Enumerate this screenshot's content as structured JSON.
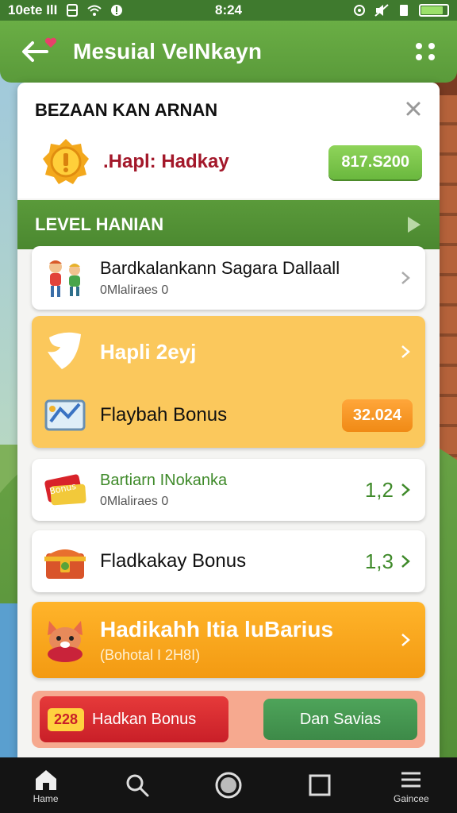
{
  "status": {
    "left_text": "10ete IlI",
    "time": "8:24"
  },
  "header": {
    "title": "Mesuial VeINkayn",
    "accent": "#5a9a3a"
  },
  "panel": {
    "title": "BEZAAN KAN ARNAN",
    "reward": {
      "label": ".Hapl: Hadkay",
      "value": "817.S200"
    },
    "level_bar": "LEVEL HANIAN"
  },
  "items": [
    {
      "title": "Bardkalankann Sagara Dallaall",
      "subtitle": "0Mlaliraes 0"
    },
    {
      "title": "Hapli 2eyj"
    },
    {
      "title": "Flaybah Bonus",
      "value": "32.024"
    },
    {
      "title": "Bartiarn INokanka",
      "subtitle": "0Mlaliraes 0",
      "value": "1,2"
    },
    {
      "title": "Fladkakay Bonus",
      "value": "1,3"
    },
    {
      "title": "Hadikahh Itia luBarius",
      "subtitle": "(Bohotal I 2H8I)"
    }
  ],
  "actions": {
    "bonus_tag": "228",
    "bonus_label": "Hadkan Bonus",
    "save_label": "Dan Savias"
  },
  "nav": {
    "home": "Hame",
    "settings": "Gaincee"
  }
}
